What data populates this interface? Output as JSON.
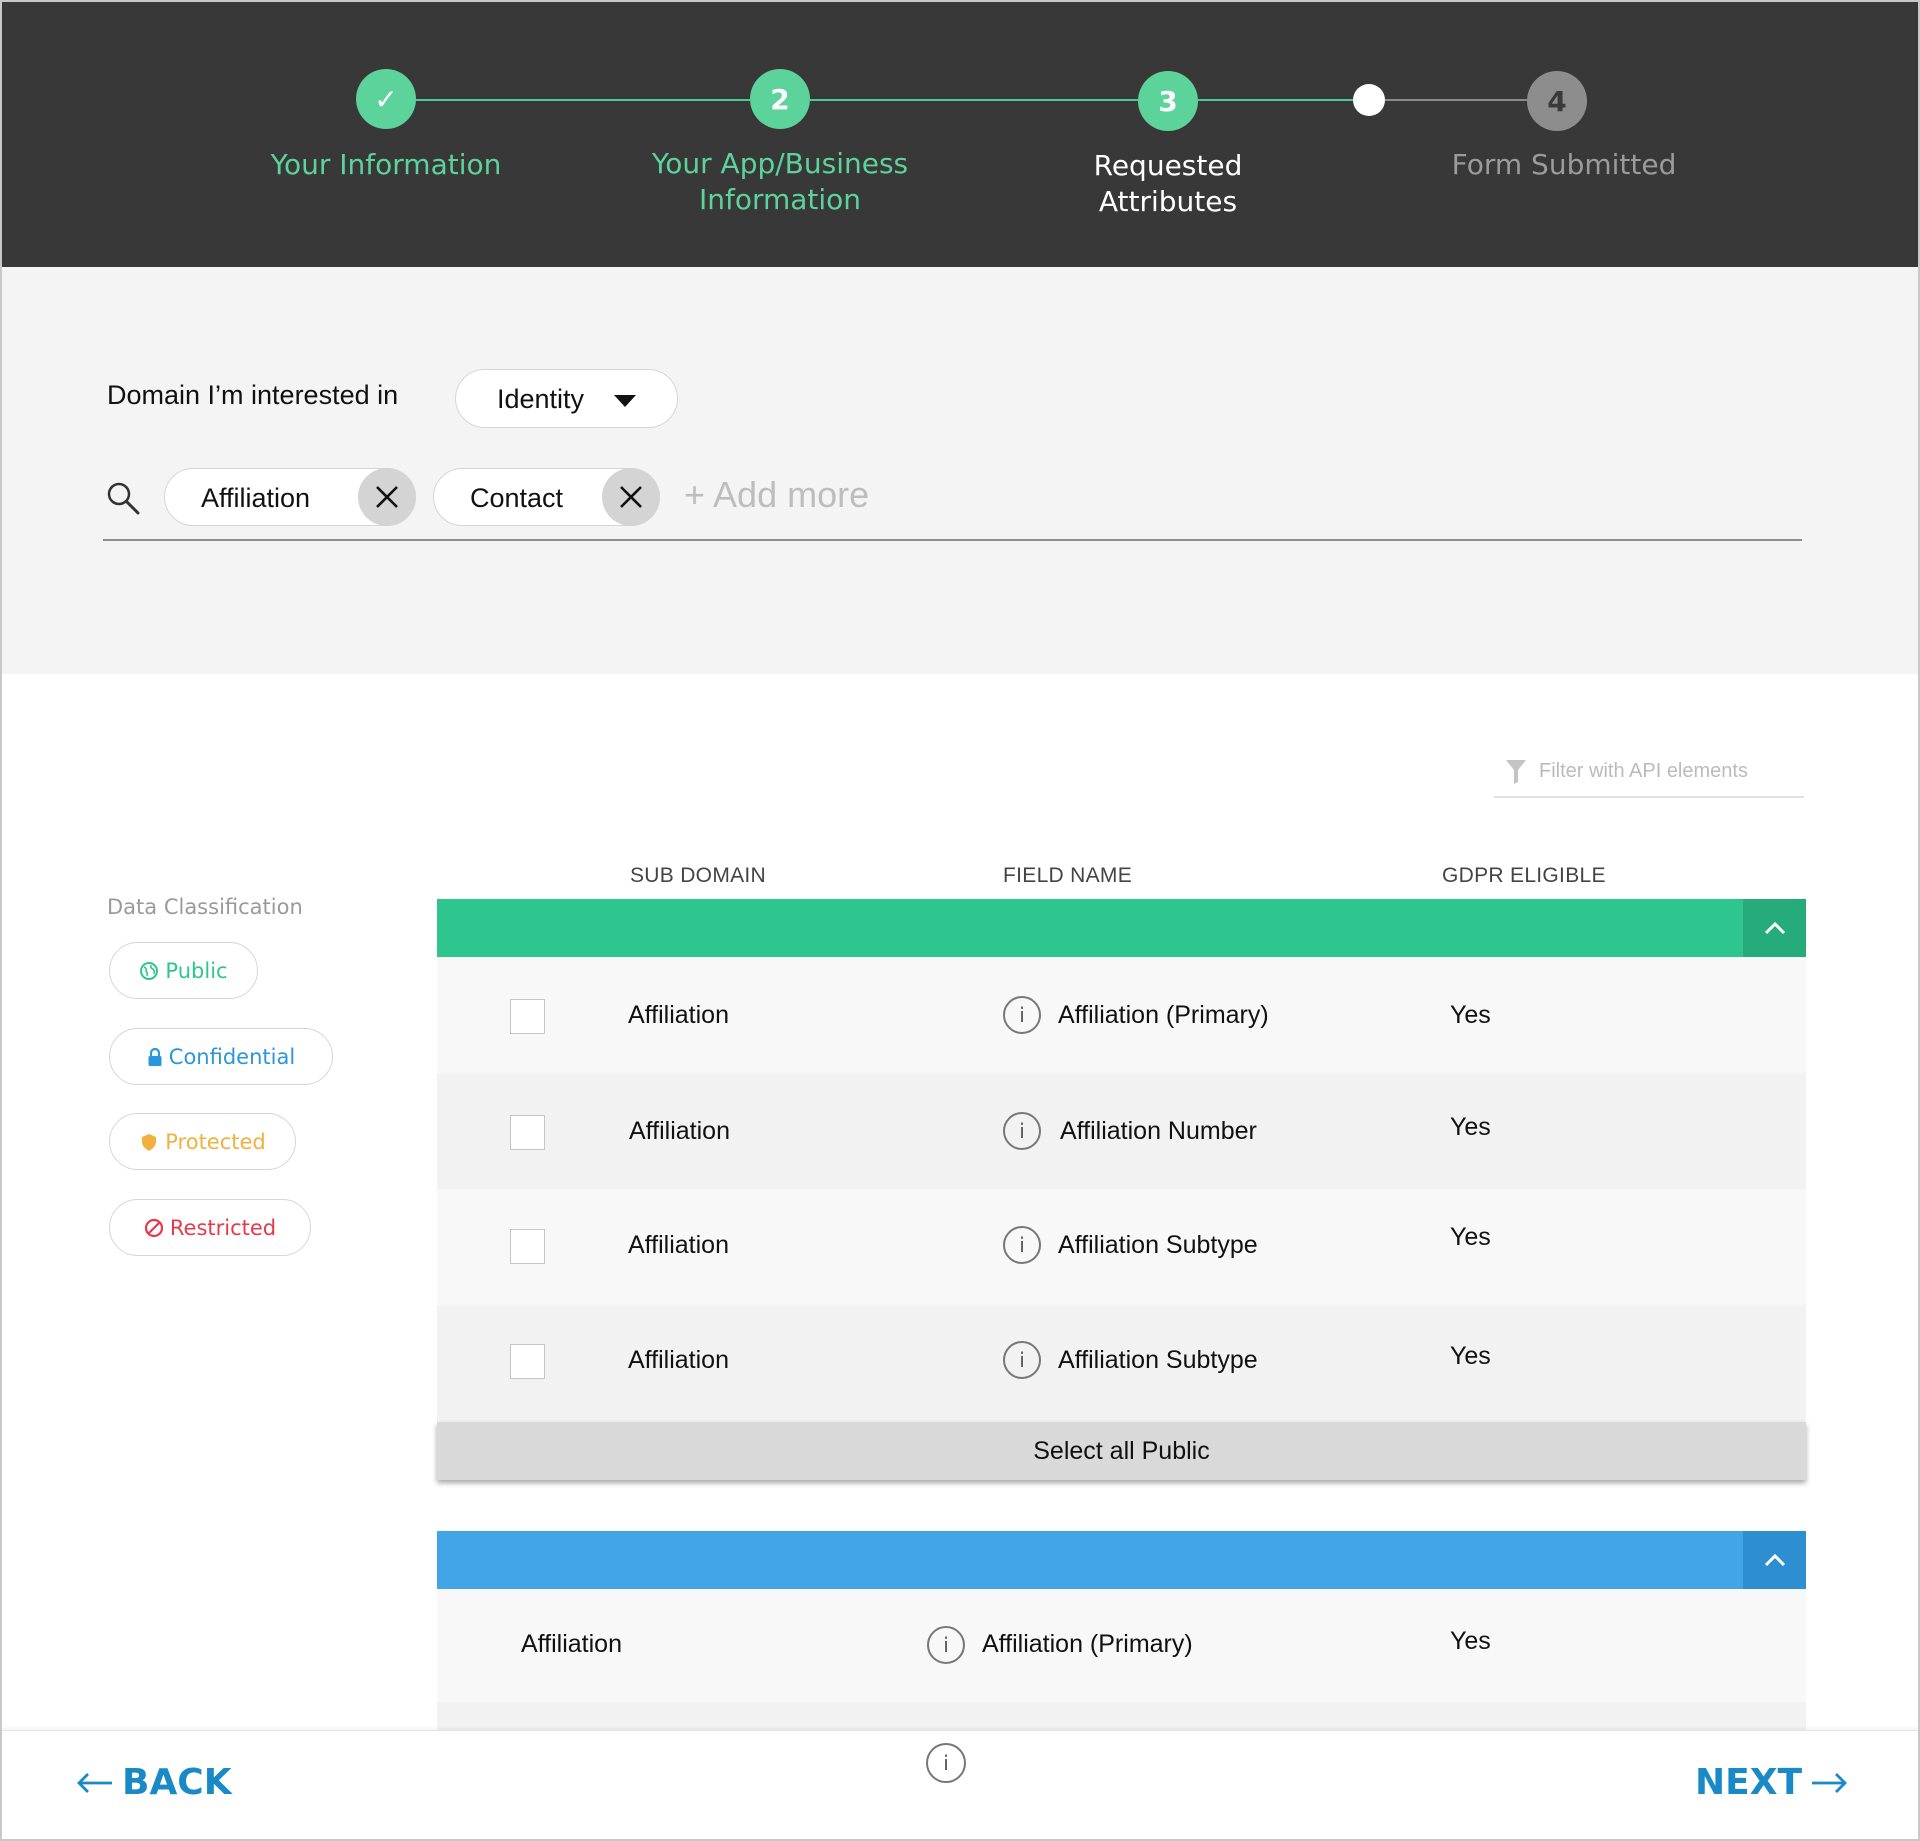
{
  "stepper": {
    "steps": [
      {
        "number": "✓",
        "label": "Your Information",
        "state": "done"
      },
      {
        "number": "2",
        "label_line1": "Your App/Business",
        "label_line2": "Information",
        "state": "done"
      },
      {
        "number": "3",
        "label_line1": "Requested",
        "label_line2": "Attributes",
        "state": "current"
      },
      {
        "number": "4",
        "label": "Form Submitted",
        "state": "future"
      }
    ],
    "colors": {
      "done": "#5cd39b",
      "future": "#8d8d8d",
      "header_bg": "#383838"
    }
  },
  "filters": {
    "domain_label": "Domain I’m interested in",
    "domain_value": "Identity",
    "chips": [
      "Affiliation",
      "Contact"
    ],
    "add_more": "+ Add more"
  },
  "api_filter": {
    "placeholder": "Filter with API elements",
    "icon": "filter-icon"
  },
  "table": {
    "headers": {
      "sub_domain": "SUB DOMAIN",
      "field_name": "FIELD NAME",
      "gdpr": "GDPR ELIGIBLE"
    },
    "public_rows": [
      {
        "sub_domain": "Affiliation",
        "field_name": "Affiliation (Primary)",
        "gdpr": "Yes"
      },
      {
        "sub_domain": "Affiliation",
        "field_name": "Affiliation Number",
        "gdpr": "Yes"
      },
      {
        "sub_domain": "Affiliation",
        "field_name": "Affiliation Subtype",
        "gdpr": "Yes"
      },
      {
        "sub_domain": "Affiliation",
        "field_name": "Affiliation Subtype",
        "gdpr": "Yes"
      }
    ],
    "select_all_label": "Select all Public",
    "confidential_rows": [
      {
        "sub_domain": "Affiliation",
        "field_name": "Affiliation (Primary)",
        "gdpr": "Yes"
      }
    ],
    "colors": {
      "public_bar": "#2ec68e",
      "public_toggle": "#25ac7a",
      "confidential_bar": "#41a5e6",
      "confidential_toggle": "#2e8fd0"
    }
  },
  "classification": {
    "label": "Data Classification",
    "items": [
      {
        "label": "Public",
        "color": "#2ec68e",
        "icon": "globe-icon"
      },
      {
        "label": "Confidential",
        "color": "#2a97dc",
        "icon": "lock-icon"
      },
      {
        "label": "Protected",
        "color": "#f0b13f",
        "icon": "shield-icon"
      },
      {
        "label": "Restricted",
        "color": "#e8394c",
        "icon": "no-entry-icon"
      }
    ]
  },
  "footer": {
    "back_label": "BACK",
    "next_label": "NEXT",
    "info_glyph": "i",
    "accent": "#1a8ac7"
  }
}
